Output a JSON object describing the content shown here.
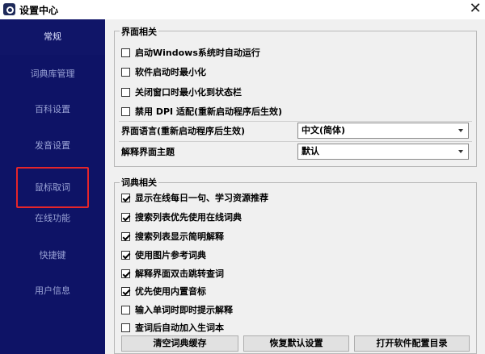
{
  "window": {
    "title": "设置中心",
    "icon": "app-logo-icon",
    "close_glyph": "✕"
  },
  "sidebar": {
    "items": [
      {
        "label": "常规",
        "state": "active"
      },
      {
        "label": "词典库管理"
      },
      {
        "label": "百科设置"
      },
      {
        "label": "发音设置"
      },
      {
        "label": "鼠标取词",
        "state": "highlighted"
      },
      {
        "label": "在线功能"
      },
      {
        "label": "快捷键"
      },
      {
        "label": "用户信息"
      }
    ]
  },
  "ui_group": {
    "title": "界面相关",
    "checkboxes": [
      {
        "label": "启动Windows系统时自动运行",
        "checked": false
      },
      {
        "label": "软件启动时最小化",
        "checked": false
      },
      {
        "label": "关闭窗口时最小化到状态栏",
        "checked": false
      },
      {
        "label": "禁用 DPI 适配(重新启动程序后生效)",
        "checked": false
      }
    ],
    "language": {
      "label": "界面语言(重新启动程序后生效)",
      "value": "中文(简体)"
    },
    "theme": {
      "label": "解释界面主题",
      "value": "默认"
    }
  },
  "dict_group": {
    "title": "词典相关",
    "checkboxes": [
      {
        "label": "显示在线每日一句、学习资源推荐",
        "checked": true
      },
      {
        "label": "搜索列表优先使用在线词典",
        "checked": true
      },
      {
        "label": "搜索列表显示简明解释",
        "checked": true
      },
      {
        "label": "使用图片参考词典",
        "checked": true
      },
      {
        "label": "解释界面双击跳转查词",
        "checked": true
      },
      {
        "label": "优先使用内置音标",
        "checked": true
      },
      {
        "label": "输入单词时即时提示解释",
        "checked": false
      },
      {
        "label": "查词后自动加入生词本",
        "checked": false
      }
    ]
  },
  "buttons": {
    "clear_cache": "清空词典缓存",
    "restore_default": "恢复默认设置",
    "open_config_dir": "打开软件配置目录"
  },
  "colors": {
    "sidebar_bg": "#0e1366",
    "sidebar_text": "#9aa3d6",
    "highlight_border": "#e5252a",
    "window_bg": "#f0f0f0"
  }
}
